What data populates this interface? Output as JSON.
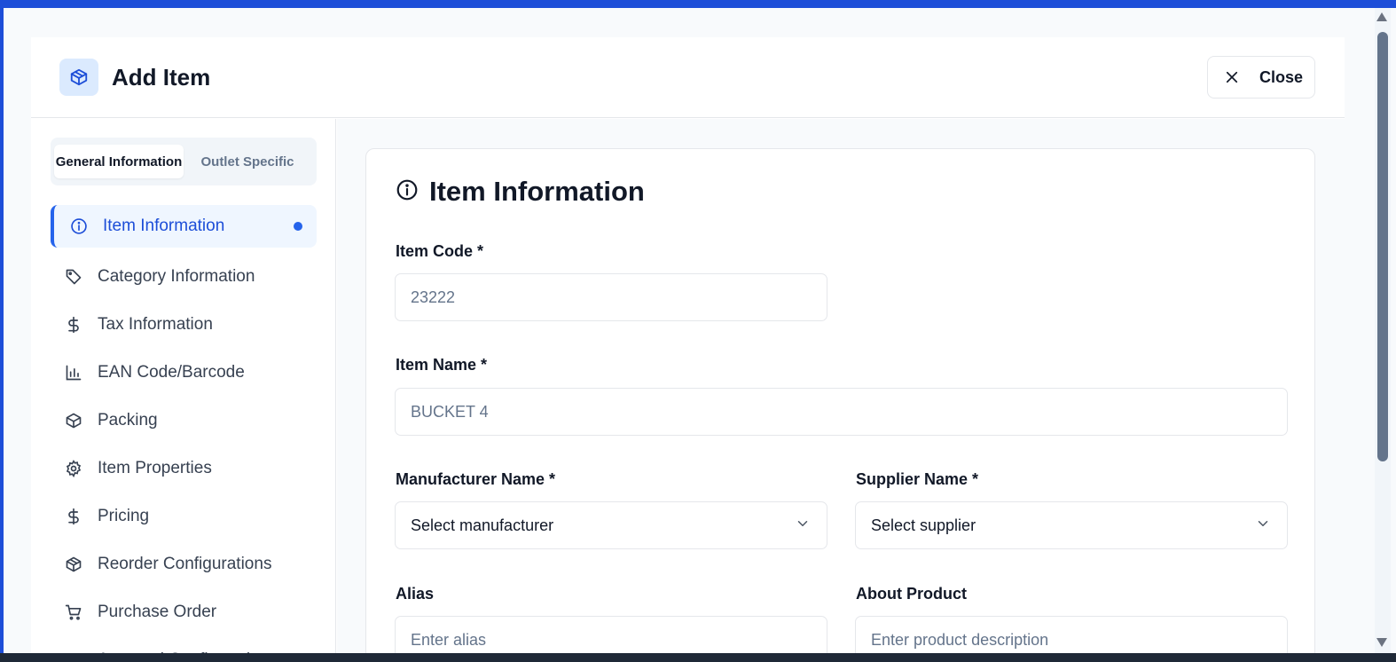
{
  "header": {
    "title": "Add Item",
    "close_label": "Close"
  },
  "tabs": [
    {
      "label": "General Information",
      "active": true
    },
    {
      "label": "Outlet Specific",
      "active": false
    }
  ],
  "sidebar": {
    "items": [
      {
        "label": "Item Information",
        "icon": "info-icon",
        "active": true
      },
      {
        "label": "Category Information",
        "icon": "tag-icon"
      },
      {
        "label": "Tax Information",
        "icon": "dollar-icon"
      },
      {
        "label": "EAN Code/Barcode",
        "icon": "bar-chart-icon"
      },
      {
        "label": "Packing",
        "icon": "package-icon"
      },
      {
        "label": "Item Properties",
        "icon": "gear-icon"
      },
      {
        "label": "Pricing",
        "icon": "dollar-icon"
      },
      {
        "label": "Reorder Configurations",
        "icon": "package-icon"
      },
      {
        "label": "Purchase Order",
        "icon": "cart-icon"
      },
      {
        "label": "Approval Configuration",
        "icon": "check-icon"
      }
    ]
  },
  "form": {
    "section_title": "Item Information",
    "item_code": {
      "label": "Item Code *",
      "placeholder": "23222"
    },
    "item_name": {
      "label": "Item Name *",
      "placeholder": "BUCKET 4"
    },
    "manufacturer": {
      "label": "Manufacturer Name *",
      "value": "Select manufacturer"
    },
    "supplier": {
      "label": "Supplier Name *",
      "value": "Select supplier"
    },
    "alias": {
      "label": "Alias",
      "placeholder": "Enter alias"
    },
    "about": {
      "label": "About Product",
      "placeholder": "Enter product description"
    }
  },
  "colors": {
    "accent": "#2563eb",
    "accent_dark": "#1d4ed8",
    "active_bg": "#eff6ff",
    "icon_bg": "#dbeafe"
  }
}
